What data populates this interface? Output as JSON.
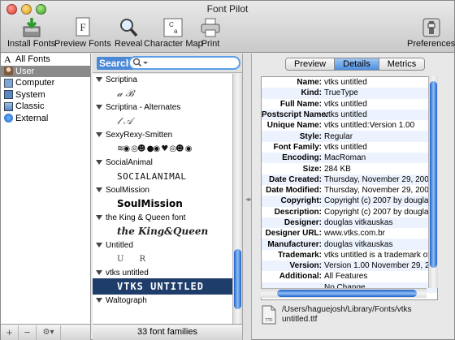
{
  "window": {
    "title": "Font Pilot"
  },
  "toolbar": {
    "install_fonts": "Install Fonts",
    "preview_fonts": "Preview Fonts",
    "reveal": "Reveal",
    "character_map": "Character Map",
    "print": "Print",
    "preferences": "Preferences"
  },
  "sources": {
    "items": [
      {
        "label": "All Fonts",
        "icon": "font-a-icon"
      },
      {
        "label": "User",
        "icon": "user-icon",
        "selected": true
      },
      {
        "label": "Computer",
        "icon": "computer-icon"
      },
      {
        "label": "System",
        "icon": "system-icon"
      },
      {
        "label": "Classic",
        "icon": "classic-icon"
      },
      {
        "label": "External",
        "icon": "globe-icon"
      }
    ],
    "add_button": "+",
    "remove_button": "−",
    "action_button": "⚙▾"
  },
  "search": {
    "label": "Search"
  },
  "font_list": {
    "families": [
      {
        "name": "Scriptina",
        "sample": "𝒶  ℬ"
      },
      {
        "name": "Scriptina - Alternates",
        "sample": "𝓁  𝒜"
      },
      {
        "name": "SexyRexy-Smitten",
        "sample": "≋◉ ◎☻ ●◉ ♥ ◎☻ ◉"
      },
      {
        "name": "SocialAnimal",
        "sample": "SOCIALANIMAL"
      },
      {
        "name": "SoulMission",
        "sample": "SoulMission"
      },
      {
        "name": "the King & Queen font",
        "sample": "the King&Queen"
      },
      {
        "name": "Untitled",
        "sample": "U      R"
      },
      {
        "name": "vtks untitled",
        "sample": "VTKS UNTITLED",
        "selected": true
      },
      {
        "name": "Waltograph",
        "sample": ""
      }
    ],
    "count_label": "33 font families"
  },
  "tabs": [
    {
      "label": "Preview"
    },
    {
      "label": "Details",
      "active": true
    },
    {
      "label": "Metrics"
    }
  ],
  "details": [
    {
      "label": "Name:",
      "value": "vtks untitled"
    },
    {
      "label": "Kind:",
      "value": "TrueType"
    },
    {
      "label": "Full Name:",
      "value": "vtks untitled"
    },
    {
      "label": "Postscript Name:",
      "value": "vtks untitled"
    },
    {
      "label": "Unique Name:",
      "value": "vtks untitled:Version 1.00"
    },
    {
      "label": "Style:",
      "value": "Regular"
    },
    {
      "label": "Font Family:",
      "value": "vtks untitled"
    },
    {
      "label": "Encoding:",
      "value": "MacRoman"
    },
    {
      "label": "Size:",
      "value": "284 KB"
    },
    {
      "label": "Date Created:",
      "value": "Thursday, November 29, 2007"
    },
    {
      "label": "Date Modified:",
      "value": "Thursday, November 29, 2007"
    },
    {
      "label": "Copyright:",
      "value": "Copyright (c) 2007 by douglas"
    },
    {
      "label": "Description:",
      "value": "Copyright (c) 2007 by douglas"
    },
    {
      "label": "Designer:",
      "value": "douglas vitkauskas"
    },
    {
      "label": "Designer URL:",
      "value": "www.vtks.com.br"
    },
    {
      "label": "Manufacturer:",
      "value": "douglas vitkauskas"
    },
    {
      "label": "Trademark:",
      "value": "vtks untitled is a trademark of"
    },
    {
      "label": "Version:",
      "value": "Version 1.00 November 29, 20"
    },
    {
      "label": "Additional:",
      "value": "All Features"
    },
    {
      "label": "",
      "value": "No Change"
    }
  ],
  "file": {
    "path_line1": "/Users/haguejosh/Library/Fonts/vtks",
    "path_line2": "untitled.ttf",
    "icon_label": "TTF"
  }
}
